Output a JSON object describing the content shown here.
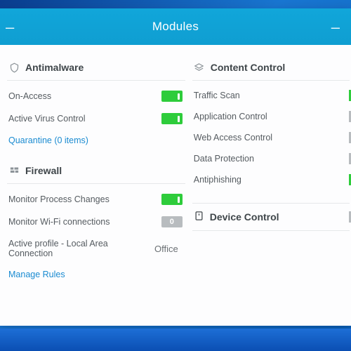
{
  "window": {
    "title": "Modules"
  },
  "left": {
    "antimalware": {
      "title": "Antimalware",
      "rows": [
        {
          "label": "On-Access",
          "toggle": "on"
        },
        {
          "label": "Active Virus Control",
          "toggle": "on"
        }
      ],
      "quarantine_link": "Quarantine (0 items)"
    },
    "firewall": {
      "title": "Firewall",
      "rows": [
        {
          "label": "Monitor Process Changes",
          "toggle": "on"
        },
        {
          "label": "Monitor Wi-Fi connections",
          "toggle": "off"
        }
      ],
      "profile_label": "Active profile - Local Area Connection",
      "profile_value": "Office",
      "manage_link": "Manage Rules"
    }
  },
  "right": {
    "content_control": {
      "title": "Content Control",
      "rows": [
        {
          "label": "Traffic Scan",
          "edge": "green"
        },
        {
          "label": "Application Control",
          "edge": "grey"
        },
        {
          "label": "Web Access Control",
          "edge": "grey"
        },
        {
          "label": "Data Protection",
          "edge": "grey"
        },
        {
          "label": "Antiphishing",
          "edge": "green"
        }
      ]
    },
    "device_control": {
      "title": "Device Control",
      "edge": "grey"
    }
  }
}
